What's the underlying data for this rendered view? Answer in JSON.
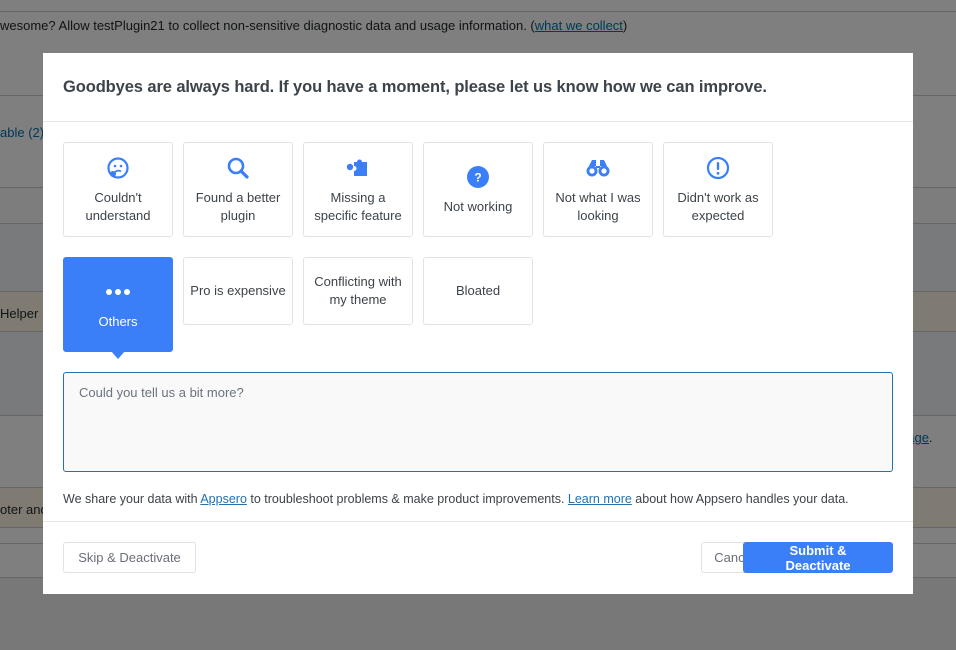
{
  "background": {
    "notice_text": "wesome? Allow testPlugin21 to collect non-sensitive diagnostic data and usage information. (",
    "notice_link": "what we collect",
    "notice_close": ")",
    "row_available": "able (2)",
    "row_helper": "Helper",
    "row_page_link": "page",
    "row_page_dot": ".",
    "row_footer": "oter and"
  },
  "modal": {
    "title": "Goodbyes are always hard. If you have a moment, please let us know how we can improve.",
    "reasons": [
      {
        "label": "Couldn't understand",
        "icon": "confused-face-icon",
        "selected": false
      },
      {
        "label": "Found a better plugin",
        "icon": "search-icon",
        "selected": false
      },
      {
        "label": "Missing a specific feature",
        "icon": "puzzle-piece-icon",
        "selected": false
      },
      {
        "label": "Not working",
        "icon": "question-circle-icon",
        "selected": false
      },
      {
        "label": "Not what I was looking",
        "icon": "binoculars-icon",
        "selected": false
      },
      {
        "label": "Didn't work as expected",
        "icon": "exclamation-circle-icon",
        "selected": false
      },
      {
        "label": "Others",
        "icon": "more-dots-icon",
        "selected": true
      },
      {
        "label": "Pro is expensive",
        "selected": false
      },
      {
        "label": "Conflicting with my theme",
        "selected": false
      },
      {
        "label": "Bloated",
        "selected": false
      }
    ],
    "textarea": {
      "placeholder": "Could you tell us a bit more?",
      "value": ""
    },
    "share": {
      "before": "We share your data with ",
      "appsero_link": "Appsero",
      "middle": " to troubleshoot problems & make product improvements. ",
      "learn_more_link": "Learn more",
      "after": " about how Appsero handles your data."
    },
    "footer": {
      "skip_label": "Skip & Deactivate",
      "cancel_label": "Cancel",
      "submit_label": "Submit & Deactivate"
    }
  },
  "colors": {
    "accent": "#3b7ff8",
    "textarea_border": "#2271b1",
    "overlay": "#808080"
  }
}
